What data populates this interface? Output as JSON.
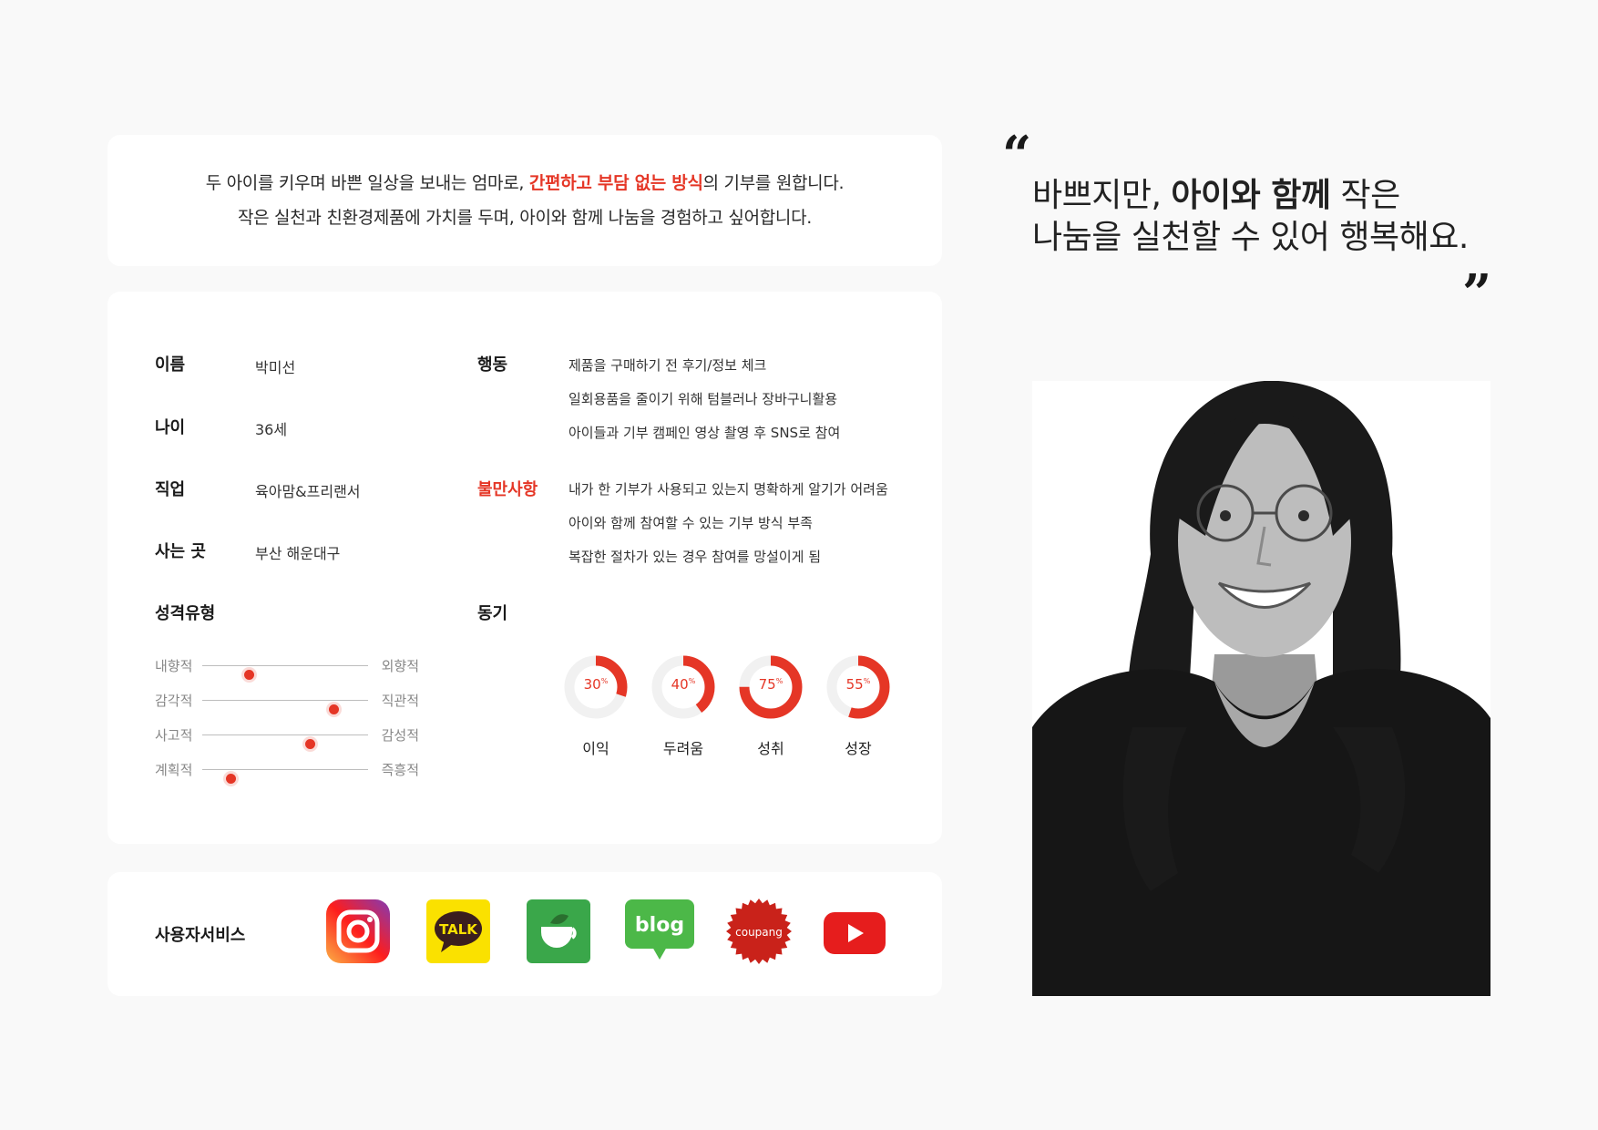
{
  "intro": {
    "line1_before": "두 아이를 키우며 바쁜 일상을 보내는 엄마로,",
    "line1_accent": "간편하고 부담 없는 방식",
    "line1_after": "의 기부를 원합니다.",
    "line2": "작은 실천과 친환경제품에 가치를 두며, 아이와 함께 나눔을 경험하고 싶어합니다."
  },
  "profile": {
    "name_label": "이름",
    "name_value": "박미선",
    "age_label": "나이",
    "age_value": "36세",
    "job_label": "직업",
    "job_value": "육아맘&프리랜서",
    "home_label": "사는 곳",
    "home_value": "부산 해운대구",
    "personality_label": "성격유형",
    "behavior_label": "행동",
    "behaviors": [
      "제품을 구매하기 전 후기/정보 체크",
      "일회용품을 줄이기 위해 텀블러나 장바구니활용",
      "아이들과 기부 캠페인 영상 촬영 후 SNS로 참여"
    ],
    "complaint_label": "불만사항",
    "complaints": [
      "내가 한 기부가 사용되고 있는지 명확하게 알기가 어려움",
      "아이와 함께 참여할 수 있는 기부 방식 부족",
      "복잡한 절차가 있는 경우 참여를 망설이게 됨"
    ],
    "motivation_label": "동기"
  },
  "traits": [
    {
      "left": "내향적",
      "right": "외향적",
      "level": 0.28
    },
    {
      "left": "감각적",
      "right": "직관적",
      "level": 0.79
    },
    {
      "left": "사고적",
      "right": "감성적",
      "level": 0.65
    },
    {
      "left": "계획적",
      "right": "즉흥적",
      "level": 0.17
    }
  ],
  "motivations": [
    {
      "label": "이익",
      "value": "30",
      "percent": 30
    },
    {
      "label": "두려움",
      "value": "40",
      "percent": 40
    },
    {
      "label": "성취",
      "value": "75",
      "percent": 75
    },
    {
      "label": "성장",
      "value": "55",
      "percent": 55
    }
  ],
  "percent_sign": "%",
  "services": {
    "label": "사용자서비스",
    "kakao_text": "TALK",
    "blog_text": "blog",
    "coupang_text": "coupang"
  },
  "quote": {
    "part1": "바쁘지만,",
    "bold": "아이와 함께",
    "part2": "작은",
    "line2": "나눔을 실천할 수 있어 행복해요.",
    "open_mark": "“",
    "close_mark": "”"
  },
  "colors": {
    "accent": "#e53626",
    "instagram_gradient": [
      "#fcb045",
      "#fd1d1d",
      "#833ab4"
    ],
    "kakao": "#fae100",
    "kakao_story": "#3aa74a",
    "naver_blog": "#4cb848",
    "coupang": "#c9221a",
    "youtube": "#e61d1d"
  }
}
